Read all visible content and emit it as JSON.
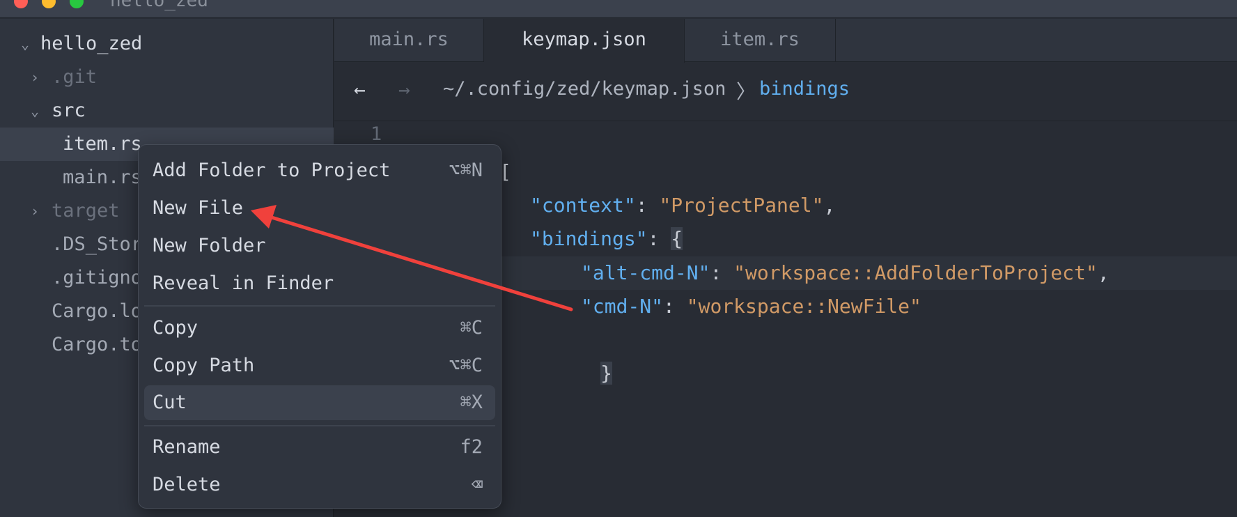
{
  "window": {
    "title": "hello_zed"
  },
  "project_panel": {
    "items": [
      {
        "label": "hello_zed",
        "chevron": "⌄"
      },
      {
        "label": ".git",
        "chevron": "›"
      },
      {
        "label": "src",
        "chevron": "⌄"
      },
      {
        "label": "item.rs"
      },
      {
        "label": "main.rs"
      },
      {
        "label": "target",
        "chevron": "›"
      },
      {
        "label": ".DS_Store"
      },
      {
        "label": ".gitignore"
      },
      {
        "label": "Cargo.lock"
      },
      {
        "label": "Cargo.toml"
      }
    ]
  },
  "tabs": [
    {
      "label": "main.rs"
    },
    {
      "label": "keymap.json",
      "active": true
    },
    {
      "label": "item.rs"
    }
  ],
  "breadcrumb": {
    "back": "←",
    "forward": "→",
    "path": "~/.config/zed/keymap.json",
    "separator": "〉",
    "leaf": "bindings"
  },
  "editor": {
    "line_number": "1",
    "open_bracket": "[",
    "context_key": "\"context\"",
    "context_value": "\"ProjectPanel\"",
    "bindings_key": "\"bindings\"",
    "open_brace": "{",
    "b1_key": "\"alt-cmd-N\"",
    "b1_value": "\"workspace::AddFolderToProject\"",
    "b2_key": "\"cmd-N\"",
    "b2_value": "\"workspace::NewFile\"",
    "close_brace": "}",
    "colon": ": ",
    "comma": ","
  },
  "context_menu": {
    "items": [
      {
        "label": "Add Folder to Project",
        "shortcut": "⌥⌘N"
      },
      {
        "label": "New File",
        "shortcut": ""
      },
      {
        "label": "New Folder",
        "shortcut": ""
      },
      {
        "label": "Reveal in Finder",
        "shortcut": ""
      },
      {
        "label": "Copy",
        "shortcut": "⌘C"
      },
      {
        "label": "Copy Path",
        "shortcut": "⌥⌘C"
      },
      {
        "label": "Cut",
        "shortcut": "⌘X"
      },
      {
        "label": "Rename",
        "shortcut": "f2"
      },
      {
        "label": "Delete",
        "shortcut": "⌫"
      }
    ]
  },
  "colors": {
    "accent_blue": "#61afef",
    "string_orange": "#d19a66",
    "annotation_arrow": "#f0413c"
  }
}
